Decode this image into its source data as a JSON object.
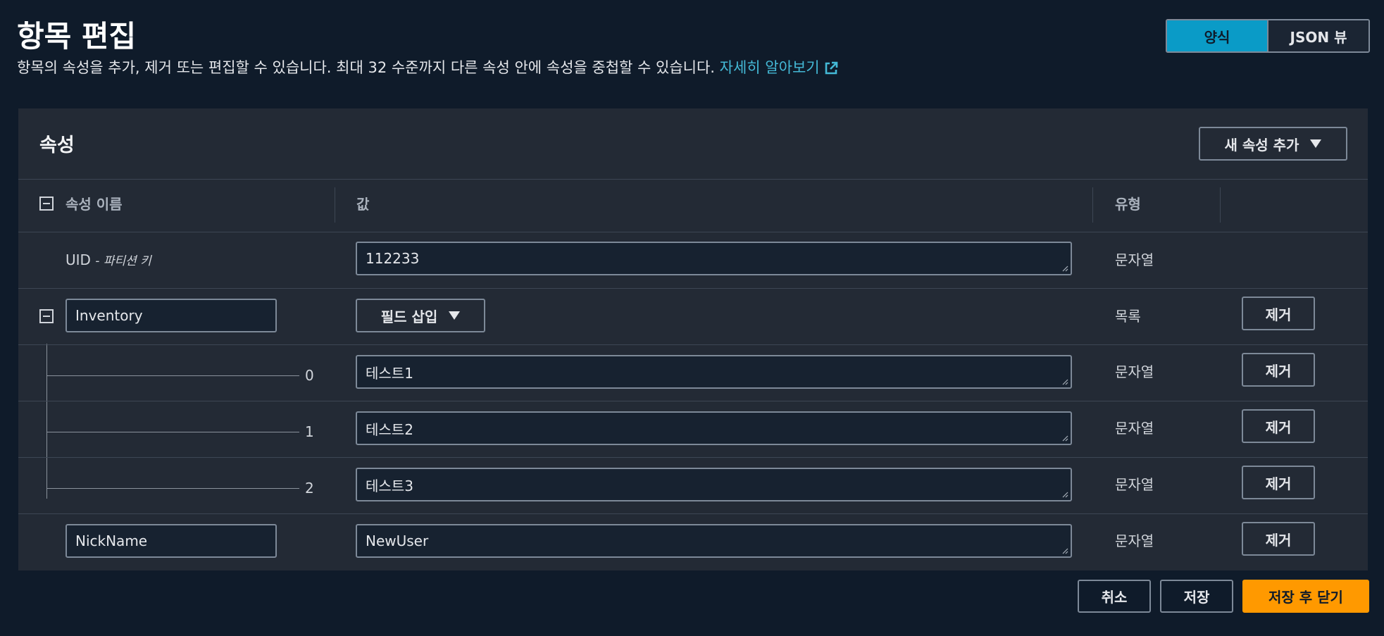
{
  "page": {
    "title": "항목 편집",
    "description": "항목의 속성을 추가, 제거 또는 편집할 수 있습니다. 최대 32 수준까지 다른 속성 안에 속성을 중첩할 수 있습니다.",
    "learn_more": "자세히 알아보기"
  },
  "view_toggle": {
    "form_label": "양식",
    "json_label": "JSON 뷰",
    "selected": "양식"
  },
  "panel": {
    "title": "속성",
    "add_attribute": "새 속성 추가"
  },
  "table": {
    "headers": {
      "name": "속성 이름",
      "value": "값",
      "type": "유형"
    },
    "partition_key": {
      "name": "UID",
      "note": "- 파티션 키",
      "value": "112233",
      "type": "문자열"
    },
    "list_attr": {
      "name": "Inventory",
      "insert_field": "필드 삽입",
      "type": "목록",
      "remove": "제거"
    },
    "list_items": [
      {
        "index": "0",
        "value": "테스트1",
        "type": "문자열",
        "remove": "제거"
      },
      {
        "index": "1",
        "value": "테스트2",
        "type": "문자열",
        "remove": "제거"
      },
      {
        "index": "2",
        "value": "테스트3",
        "type": "문자열",
        "remove": "제거"
      }
    ],
    "nickname": {
      "name": "NickName",
      "value": "NewUser",
      "type": "문자열",
      "remove": "제거"
    }
  },
  "footer": {
    "cancel": "취소",
    "save": "저장",
    "save_close": "저장 후 닫기"
  },
  "colors": {
    "background": "#0f1b2a",
    "panel": "#232a35",
    "accent": "#0a9bc7",
    "primary": "#ff9900",
    "link": "#44b9d6"
  }
}
